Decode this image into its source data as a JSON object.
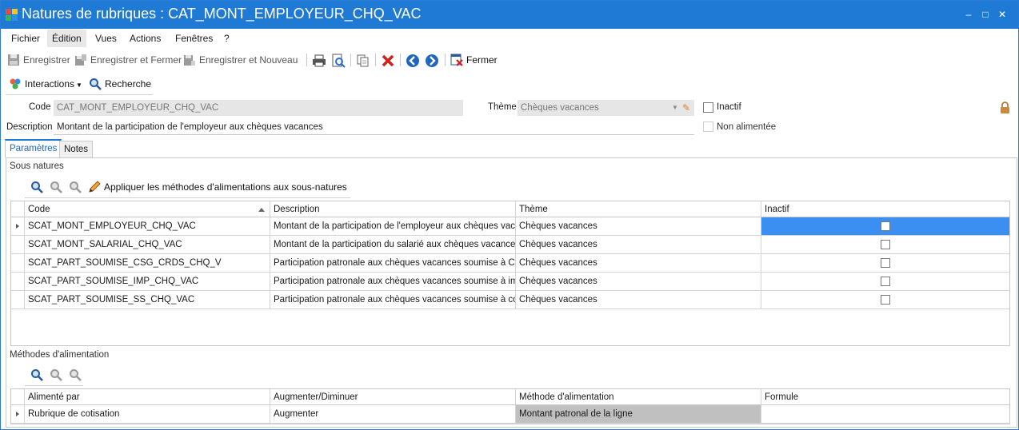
{
  "window": {
    "title": "Natures de rubriques : CAT_MONT_EMPLOYEUR_CHQ_VAC",
    "minimize": "–",
    "maximize": "□",
    "close": "✕",
    "titlebar_color": "#1f7ad6"
  },
  "menu": {
    "items": [
      "Fichier",
      "Édition",
      "Vues",
      "Actions",
      "Fenêtres",
      "?"
    ]
  },
  "toolbar": {
    "save": "Enregistrer",
    "save_close": "Enregistrer et Fermer",
    "save_new": "Enregistrer et Nouveau",
    "close": "Fermer"
  },
  "interbar": {
    "interactions": "Interactions",
    "search": "Recherche"
  },
  "form": {
    "code_label": "Code",
    "code_value": "CAT_MONT_EMPLOYEUR_CHQ_VAC",
    "theme_label": "Thème",
    "theme_value": "Chèques vacances",
    "inactif_label": "Inactif",
    "description_label": "Description",
    "description_value": "Montant de la participation de l'employeur aux chèques vacances",
    "non_alimentee_label": "Non alimentée"
  },
  "tabs": [
    {
      "label": "Paramètres"
    },
    {
      "label": "Notes"
    }
  ],
  "sous_natures": {
    "title": "Sous natures",
    "apply_label": "Appliquer les méthodes d'alimentations aux sous-natures",
    "columns": [
      "Code",
      "Description",
      "Thème",
      "Inactif"
    ],
    "rows": [
      {
        "code": "SCAT_MONT_EMPLOYEUR_CHQ_VAC",
        "description": "Montant de la participation de l'employeur aux chèques vaca...",
        "theme": "Chèques vacances"
      },
      {
        "code": "SCAT_MONT_SALARIAL_CHQ_VAC",
        "description": "Montant de la participation du salarié aux chèques vacances",
        "theme": "Chèques vacances"
      },
      {
        "code": "SCAT_PART_SOUMISE_CSG_CRDS_CHQ_V",
        "description": "Participation patronale aux chèques vacances soumise à CS...",
        "theme": "Chèques vacances"
      },
      {
        "code": "SCAT_PART_SOUMISE_IMP_CHQ_VAC",
        "description": "Participation patronale aux chèques vacances soumise à imp...",
        "theme": "Chèques vacances"
      },
      {
        "code": "SCAT_PART_SOUMISE_SS_CHQ_VAC",
        "description": "Participation patronale aux chèques vacances soumise à coti...",
        "theme": "Chèques vacances"
      }
    ],
    "selected_color": "#3b8ff0"
  },
  "methodes": {
    "title": "Méthodes d'alimentation",
    "columns": [
      "Alimenté par",
      "Augmenter/Diminuer",
      "Méthode d'alimentation",
      "Formule"
    ],
    "rows": [
      {
        "alimente_par": "Rubrique de cotisation",
        "augmenter": "Augmenter",
        "methode": "Montant patronal de la ligne",
        "formule": ""
      }
    ]
  }
}
